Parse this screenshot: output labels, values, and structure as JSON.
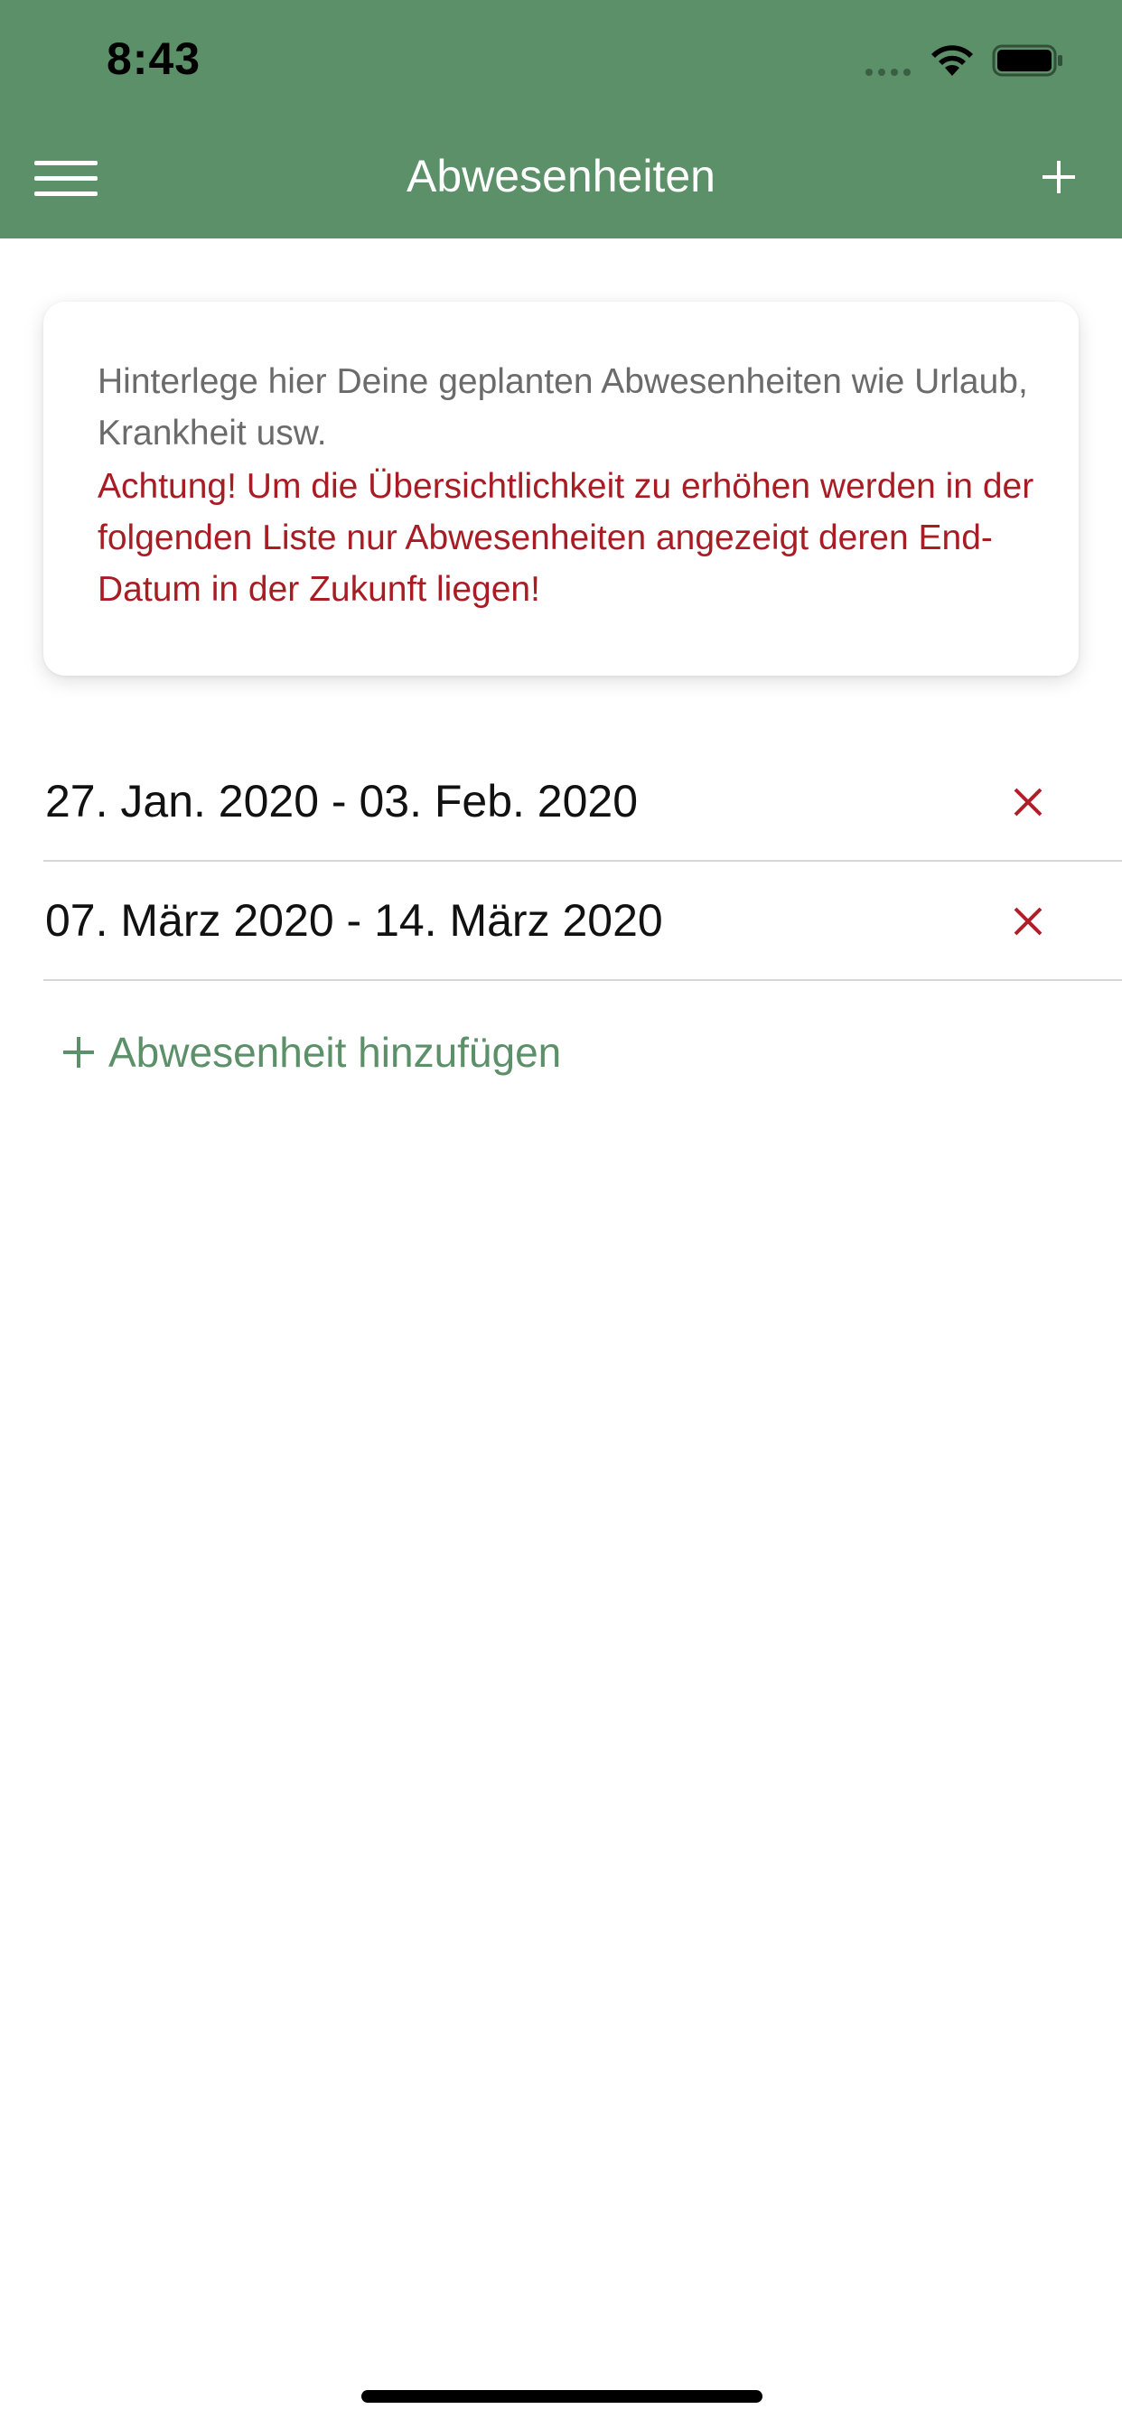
{
  "status_bar": {
    "time": "8:43"
  },
  "nav": {
    "title": "Abwesenheiten"
  },
  "info_card": {
    "text": "Hinterlege hier Deine geplanten Abwesenheiten wie Urlaub, Krankheit usw.",
    "warning": "Achtung! Um die Übersichtlichkeit zu erhöhen werden in der folgenden Liste nur Abwesenheiten angezeigt deren End-Datum in der Zukunft liegen!"
  },
  "absences": [
    {
      "range": "27. Jan. 2020 - 03. Feb. 2020"
    },
    {
      "range": "07. März 2020 - 14. März 2020"
    }
  ],
  "add_absence": {
    "label": "Abwesenheit hinzufügen"
  },
  "colors": {
    "brand_green": "#5b9068",
    "warning_red": "#a81c24",
    "delete_red": "#b01e28"
  },
  "icons": [
    "menu-icon",
    "add-icon",
    "wifi-icon",
    "battery-icon",
    "delete-icon",
    "plus-icon"
  ]
}
